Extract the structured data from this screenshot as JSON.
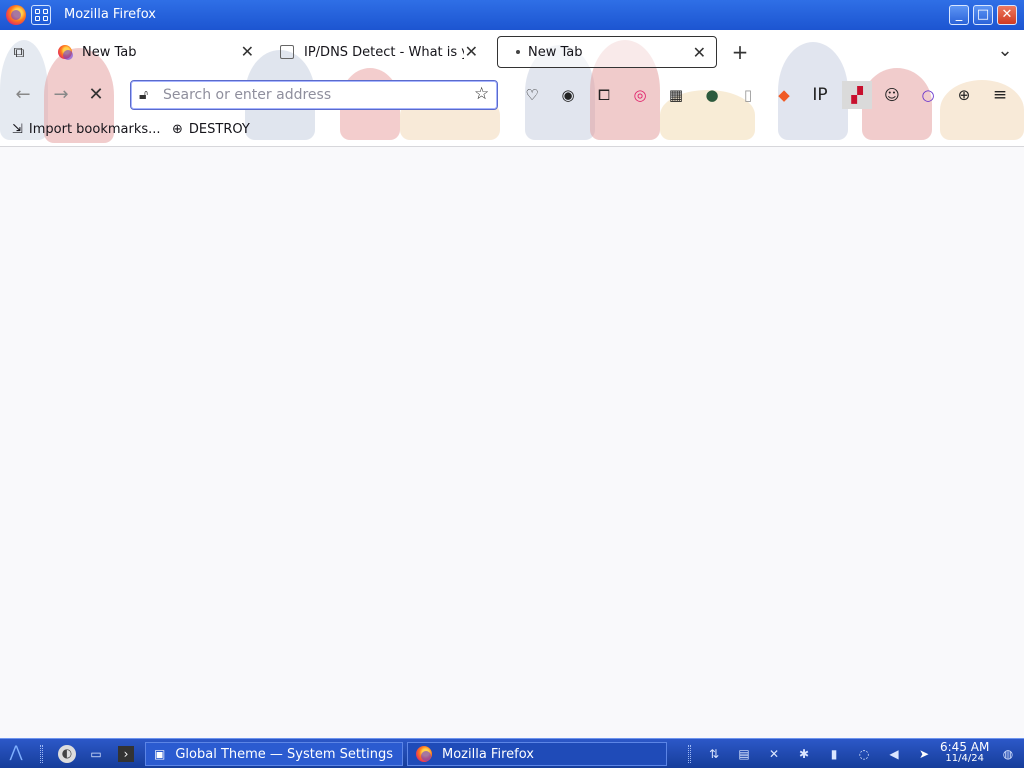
{
  "window": {
    "title": "Mozilla Firefox",
    "buttons": [
      "_",
      "□",
      "✕"
    ]
  },
  "tabs": [
    {
      "label": "New Tab",
      "active": false
    },
    {
      "label": "IP/DNS Detect - What is yo",
      "active": false
    },
    {
      "label": "New Tab",
      "active": true
    }
  ],
  "tabbar": {
    "new_tab": "+",
    "list_all": "⌄"
  },
  "nav": {
    "back": "←",
    "forward": "→",
    "stop": "✕"
  },
  "urlbar": {
    "placeholder": "Search or enter address",
    "value": ""
  },
  "extensions": [
    "pocket-icon",
    "account-icon",
    "extensions-icon",
    "rss-icon",
    "apps-icon",
    "dark-circle-icon",
    "cup-icon",
    "brave-icon"
  ],
  "toolbar_text": {
    "ip": "IP"
  },
  "bookmarks": [
    {
      "label": "Import bookmarks...",
      "icon": "import-icon"
    },
    {
      "label": "DESTROY",
      "icon": "globe-icon"
    }
  ],
  "taskbar": {
    "tasks": [
      {
        "label": "Global Theme — System Settings"
      },
      {
        "label": "Mozilla Firefox"
      }
    ],
    "clock": {
      "time": "6:45 AM",
      "date": "11/4/24"
    }
  },
  "colors": {
    "titlebar": "#1c55d1",
    "taskbar": "#163d9a",
    "accent": "#5b6acb",
    "content_bg": "#f9f9fb"
  }
}
